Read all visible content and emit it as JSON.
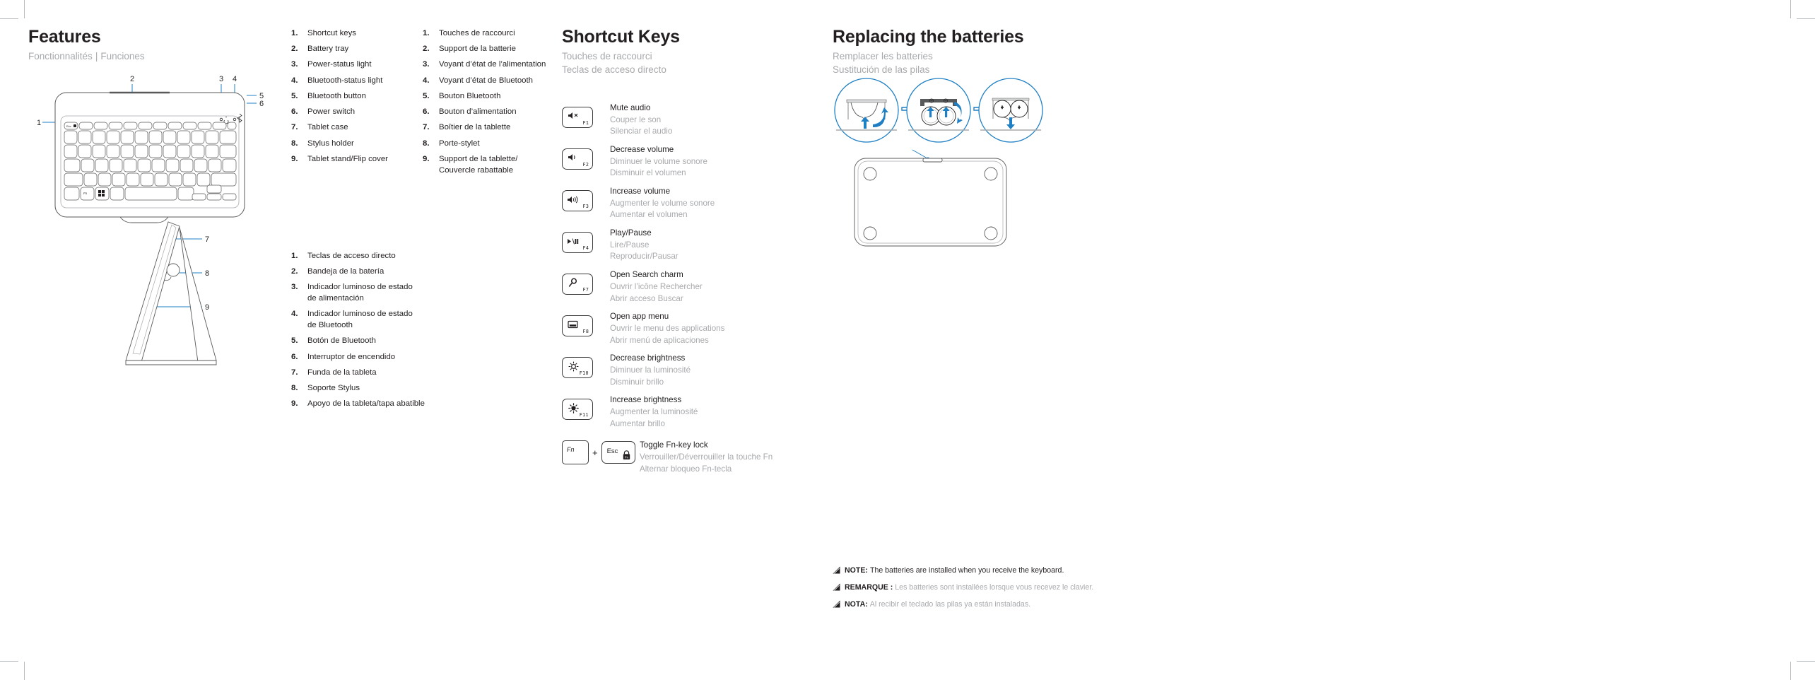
{
  "features": {
    "title": "Features",
    "subtitle_fr": "Fonctionnalités",
    "subtitle_divider": "|",
    "subtitle_es": "Funciones",
    "callouts": [
      "1",
      "2",
      "3",
      "4",
      "5",
      "6",
      "7",
      "8",
      "9"
    ]
  },
  "lists": {
    "en": [
      {
        "num": "1.",
        "text": "Shortcut keys"
      },
      {
        "num": "2.",
        "text": "Battery tray"
      },
      {
        "num": "3.",
        "text": "Power-status light"
      },
      {
        "num": "4.",
        "text": "Bluetooth-status light"
      },
      {
        "num": "5.",
        "text": "Bluetooth button"
      },
      {
        "num": "6.",
        "text": "Power switch"
      },
      {
        "num": "7.",
        "text": "Tablet case"
      },
      {
        "num": "8.",
        "text": "Stylus holder"
      },
      {
        "num": "9.",
        "text": "Tablet stand/Flip cover"
      }
    ],
    "fr": [
      {
        "num": "1.",
        "text": "Touches de raccourci"
      },
      {
        "num": "2.",
        "text": "Support de la batterie"
      },
      {
        "num": "3.",
        "text": "Voyant d’état de l’alimentation"
      },
      {
        "num": "4.",
        "text": "Voyant d’état de Bluetooth"
      },
      {
        "num": "5.",
        "text": "Bouton Bluetooth"
      },
      {
        "num": "6.",
        "text": "Bouton d’alimentation"
      },
      {
        "num": "7.",
        "text": "Boîtier de la tablette"
      },
      {
        "num": "8.",
        "text": "Porte-stylet"
      },
      {
        "num": "9.",
        "text": "Support de la tablette/\nCouvercle rabattable"
      }
    ],
    "es": [
      {
        "num": "1.",
        "text": "Teclas de acceso directo"
      },
      {
        "num": "2.",
        "text": "Bandeja de la batería"
      },
      {
        "num": "3.",
        "text": "Indicador luminoso de estado\nde alimentación"
      },
      {
        "num": "4.",
        "text": "Indicador luminoso de estado\nde Bluetooth"
      },
      {
        "num": "5.",
        "text": "Botón de Bluetooth"
      },
      {
        "num": "6.",
        "text": "Interruptor de encendido"
      },
      {
        "num": "7.",
        "text": "Funda de la tableta"
      },
      {
        "num": "8.",
        "text": "Soporte Stylus"
      },
      {
        "num": "9.",
        "text": "Apoyo de la tableta/tapa abatible"
      }
    ]
  },
  "shortcuts": {
    "title": "Shortcut Keys",
    "subtitle_fr": "Touches de raccourci",
    "subtitle_es": "Teclas de acceso directo",
    "rows": [
      {
        "key": "F1",
        "icon": "mute-audio-icon",
        "en": "Mute audio",
        "fr": "Couper le son",
        "es": "Silenciar el audio"
      },
      {
        "key": "F2",
        "icon": "volume-down-icon",
        "en": "Decrease volume",
        "fr": "Diminuer le volume sonore",
        "es": "Disminuir el volumen"
      },
      {
        "key": "F3",
        "icon": "volume-up-icon",
        "en": "Increase volume",
        "fr": "Augmenter le volume sonore",
        "es": "Aumentar el volumen"
      },
      {
        "key": "F4",
        "icon": "play-pause-icon",
        "en": "Play/Pause",
        "fr": "Lire/Pause",
        "es": "Reproducir/Pausar"
      },
      {
        "key": "F7",
        "icon": "search-icon",
        "en": "Open Search charm",
        "fr": "Ouvrir l’icône Rechercher",
        "es": "Abrir acceso Buscar"
      },
      {
        "key": "F8",
        "icon": "app-menu-icon",
        "en": "Open app menu",
        "fr": "Ouvrir le menu des applications",
        "es": "Abrir menú de aplicaciones"
      },
      {
        "key": "F10",
        "icon": "brightness-down-icon",
        "en": "Decrease brightness",
        "fr": "Diminuer la luminosité",
        "es": "Disminuir brillo"
      },
      {
        "key": "F11",
        "icon": "brightness-up-icon",
        "en": "Increase brightness",
        "fr": "Augmenter la luminosité",
        "es": "Aumentar brillo"
      },
      {
        "key": "Esc",
        "icon": "fn-lock-icon",
        "combo_first": "Fn",
        "combo_plus": "+",
        "en": "Toggle Fn-key lock",
        "fr": "Verrouiller/Déverrouiller la touche Fn",
        "es": "Alternar bloqueo Fn-tecla"
      }
    ]
  },
  "battery": {
    "title": "Replacing the batteries",
    "subtitle_fr": "Remplacer les batteries",
    "subtitle_es": "Sustitución de las pilas",
    "notes": [
      {
        "lang": "en",
        "label": "NOTE:",
        "body": "The batteries are installed when you receive the keyboard."
      },
      {
        "lang": "fr",
        "label": "REMARQUE :",
        "body": "Les batteries sont installées lorsque vous recevez le clavier."
      },
      {
        "lang": "es",
        "label": "NOTA:",
        "body": "Al recibir el teclado las pilas ya están instaladas."
      }
    ]
  },
  "colors": {
    "accent_blue": "#1f7fc4",
    "text_dark": "#231f20",
    "text_muted": "#a7a9ac"
  }
}
